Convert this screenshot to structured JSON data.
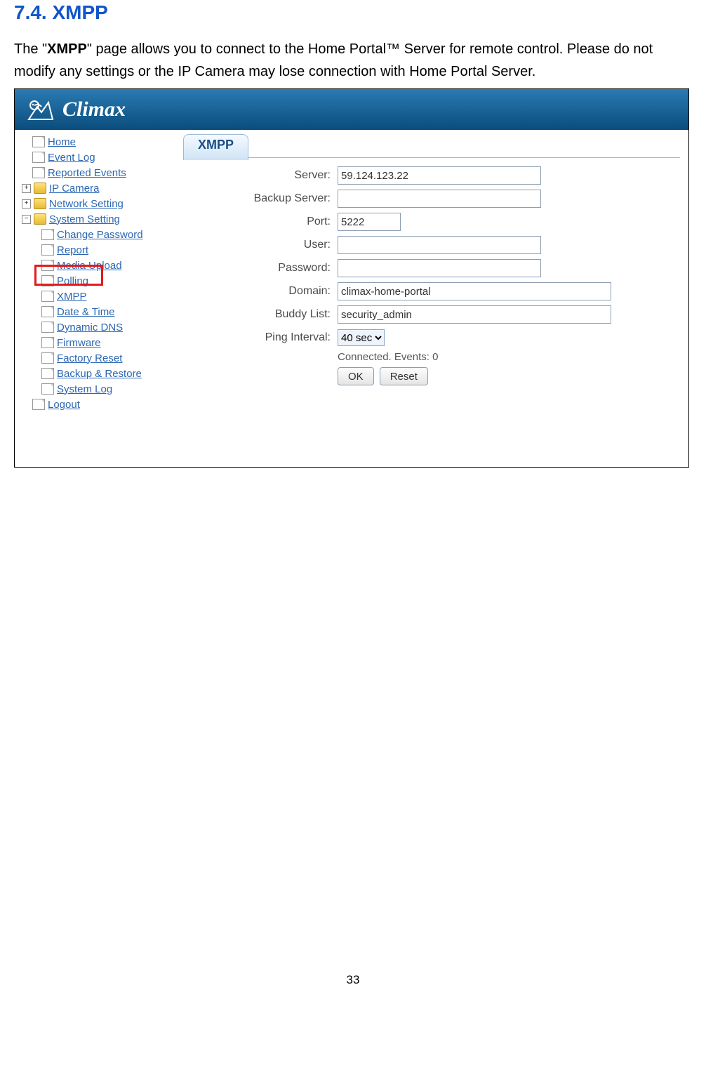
{
  "section": {
    "number": "7.4.",
    "title": "XMPP"
  },
  "body": {
    "line1_prefix": "The \"",
    "line1_bold": "XMPP",
    "line1_suffix": "\" page allows you to connect to the Home Portal™ Server for remote control. Please do not modify any settings or the IP Camera may lose connection with Home Portal Server."
  },
  "logo_text": "Climax",
  "sidebar": {
    "home": "Home",
    "eventlog": "Event Log",
    "reported": "Reported Events",
    "ipcamera": "IP Camera",
    "network": "Network Setting",
    "system": "System Setting",
    "changepw": "Change Password",
    "report": "Report",
    "mediaupload": "Media Upload",
    "polling": "Polling",
    "xmpp": "XMPP",
    "datetime": "Date & Time",
    "ddns": "Dynamic DNS",
    "firmware": "Firmware",
    "factoryreset": "Factory Reset",
    "backup": "Backup & Restore",
    "syslog": "System Log",
    "logout": "Logout"
  },
  "tab_label": "XMPP",
  "form": {
    "server_label": "Server:",
    "server_value": "59.124.123.22",
    "backup_label": "Backup Server:",
    "backup_value": "",
    "port_label": "Port:",
    "port_value": "5222",
    "user_label": "User:",
    "user_value": "",
    "password_label": "Password:",
    "password_value": "",
    "domain_label": "Domain:",
    "domain_value": "climax-home-portal",
    "buddy_label": "Buddy List:",
    "buddy_value": "security_admin",
    "ping_label": "Ping Interval:",
    "ping_value": "40 sec"
  },
  "status_text": "Connected. Events: 0",
  "buttons": {
    "ok": "OK",
    "reset": "Reset"
  },
  "page_number": "33"
}
